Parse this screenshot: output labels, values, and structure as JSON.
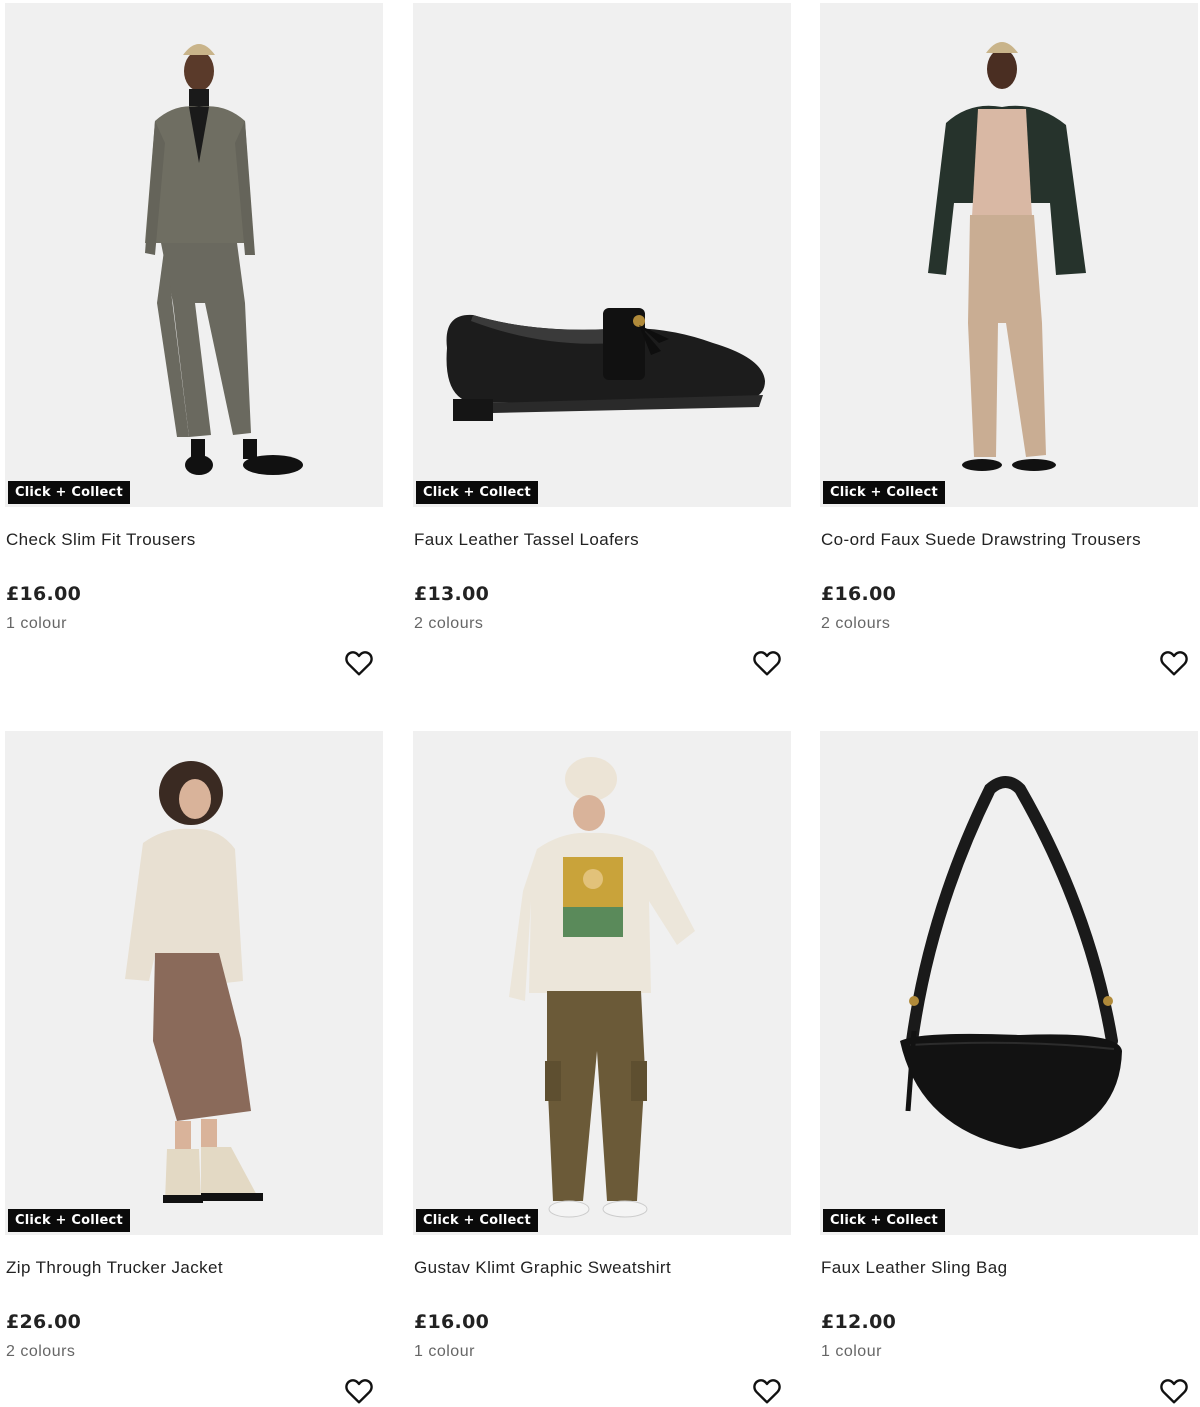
{
  "badge_text": "Click + Collect",
  "products": [
    {
      "name": "Check Slim Fit Trousers",
      "price": "£16.00",
      "colours": "1 colour",
      "badge": "Click + Collect",
      "image": "model-check-suit"
    },
    {
      "name": "Faux Leather Tassel Loafers",
      "price": "£13.00",
      "colours": "2 colours",
      "badge": "Click + Collect",
      "image": "black-tassel-loafer"
    },
    {
      "name": "Co-ord Faux Suede Drawstring Trousers",
      "price": "£16.00",
      "colours": "2 colours",
      "badge": "Click + Collect",
      "image": "model-bomber-beige-trousers"
    },
    {
      "name": "Zip Through Trucker Jacket",
      "price": "£26.00",
      "colours": "2 colours",
      "badge": "Click + Collect",
      "image": "model-cream-jacket-brown-skirt"
    },
    {
      "name": "Gustav Klimt Graphic Sweatshirt",
      "price": "£16.00",
      "colours": "1 colour",
      "badge": "Click + Collect",
      "image": "model-klimt-sweatshirt"
    },
    {
      "name": "Faux Leather Sling Bag",
      "price": "£12.00",
      "colours": "1 colour",
      "badge": "Click + Collect",
      "image": "black-sling-bag"
    }
  ],
  "icons": {
    "wishlist": "heart-outline-icon"
  },
  "colors": {
    "badge_bg": "#0a0a0a",
    "badge_text": "#ffffff",
    "image_bg": "#f0f0f0",
    "price": "#222222",
    "muted": "#666666"
  }
}
